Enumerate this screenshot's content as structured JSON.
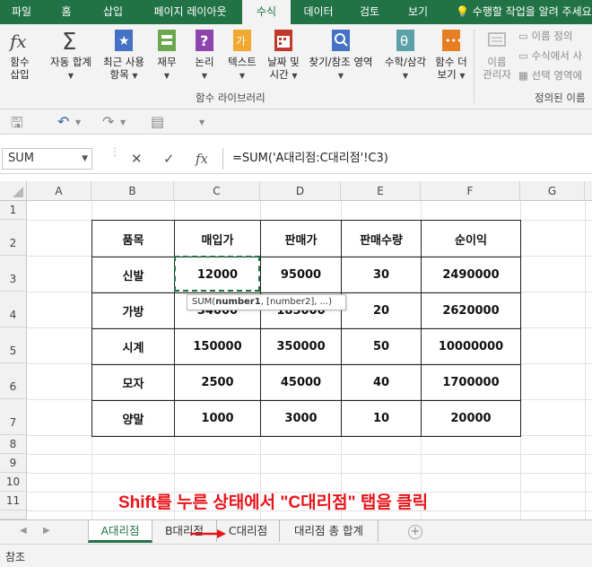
{
  "tabs": [
    {
      "label": "파일"
    },
    {
      "label": "홈"
    },
    {
      "label": "삽입"
    },
    {
      "label": "페이지 레이아웃"
    },
    {
      "label": "수식"
    },
    {
      "label": "데이터"
    },
    {
      "label": "검토"
    },
    {
      "label": "보기"
    }
  ],
  "tell_me": "수행할 작업을 알려 주세요",
  "ribbon": {
    "insert_function": {
      "line1": "함수",
      "line2": "삽입"
    },
    "autosum": {
      "label": "자동 합계"
    },
    "recent": {
      "line1": "최근 사용",
      "line2": "항목"
    },
    "financial": {
      "label": "재무"
    },
    "logical": {
      "label": "논리"
    },
    "text": {
      "label": "텍스트"
    },
    "datetime": {
      "line1": "날짜 및",
      "line2": "시간"
    },
    "lookup": {
      "label": "찾기/참조 영역"
    },
    "math": {
      "label": "수학/삼각"
    },
    "more": {
      "line1": "함수 더",
      "line2": "보기"
    },
    "name_manager": {
      "line1": "이름",
      "line2": "관리자"
    },
    "define_name": "이름 정의",
    "use_in_formula": "수식에서 사",
    "create_from_selection": "선택 영역에",
    "group_library": "함수 라이브러리",
    "group_defined_names": "정의된 이름"
  },
  "formula_bar": {
    "name_box": "SUM",
    "cancel_icon": "✕",
    "enter_icon": "✓",
    "fx_icon": "fx",
    "formula": "=SUM('A대리점:C대리점'!C3)"
  },
  "columns": [
    "A",
    "B",
    "C",
    "D",
    "E",
    "F",
    "G"
  ],
  "rows": [
    "1",
    "2",
    "3",
    "4",
    "5",
    "6",
    "7",
    "8",
    "9",
    "10",
    "11"
  ],
  "table": {
    "headers": [
      "품목",
      "매입가",
      "판매가",
      "판매수량",
      "순이익"
    ],
    "rows": [
      [
        "신발",
        "12000",
        "95000",
        "30",
        "2490000"
      ],
      [
        "가방",
        "34000",
        "185000",
        "20",
        "2620000"
      ],
      [
        "시계",
        "150000",
        "350000",
        "50",
        "10000000"
      ],
      [
        "모자",
        "2500",
        "45000",
        "40",
        "1700000"
      ],
      [
        "양말",
        "1000",
        "3000",
        "10",
        "20000"
      ]
    ]
  },
  "tooltip": {
    "fn": "SUM(",
    "arg1": "number1",
    "rest": ", [number2], ...)"
  },
  "instruction": "Shift를 누른 상태에서 \"C대리점\" 탭을 클릭",
  "sheets": [
    "A대리점",
    "B대리점",
    "C대리점",
    "대리점 총 합계"
  ],
  "status": "참조",
  "colors": {
    "accent": "#217346",
    "instruction": "#e8141a"
  }
}
